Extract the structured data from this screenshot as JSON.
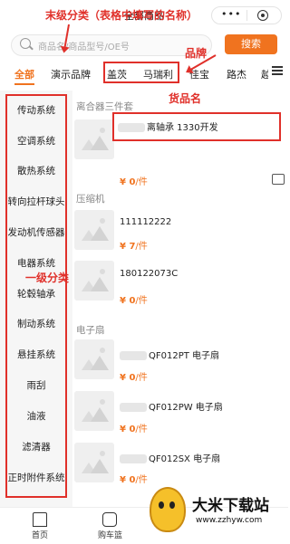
{
  "header": {
    "title": "全部商品"
  },
  "search": {
    "placeholder": "商品名/商品型号/OE号",
    "button": "搜索"
  },
  "brand_tabs": [
    "全部",
    "演示品牌",
    "盖茨",
    "马瑞利",
    "佳宝",
    "路杰",
    "越"
  ],
  "sidebar": {
    "items": [
      "传动系统",
      "空调系统",
      "散热系统",
      "转向拉杆球头",
      "发动机传感器",
      "电器系统",
      "轮毂轴承",
      "制动系统",
      "悬挂系统",
      "雨刮",
      "油液",
      "滤清器",
      "正时附件系统"
    ]
  },
  "groups": [
    {
      "header": "离合器三件套"
    },
    {
      "header": "压缩机"
    },
    {
      "header": "电子扇"
    }
  ],
  "products": [
    {
      "name": "离轴承 1330开发",
      "price": "0",
      "unit": "/件"
    },
    {
      "name": "111112222",
      "price": "7",
      "unit": "/件"
    },
    {
      "name": "180122073C",
      "price": "0",
      "unit": "/件"
    },
    {
      "name": "QF012PT 电子扇",
      "price": "0",
      "unit": "/件"
    },
    {
      "name": "QF012PW 电子扇",
      "price": "0",
      "unit": "/件"
    },
    {
      "name": "QF012SX 电子扇",
      "price": "0",
      "unit": "/件"
    }
  ],
  "currency": "¥",
  "annotations": {
    "last_level": "末级分类（表格中填写的名称）",
    "brand": "品牌",
    "product_name": "货品名",
    "first_level": "一级分类"
  },
  "bottom_nav": [
    "首页",
    "购车篮"
  ],
  "watermark": {
    "title": "大米下载站",
    "url": "www.zzhyw.com"
  },
  "colors": {
    "accent": "#f0731f",
    "annotation": "#e0302a"
  }
}
